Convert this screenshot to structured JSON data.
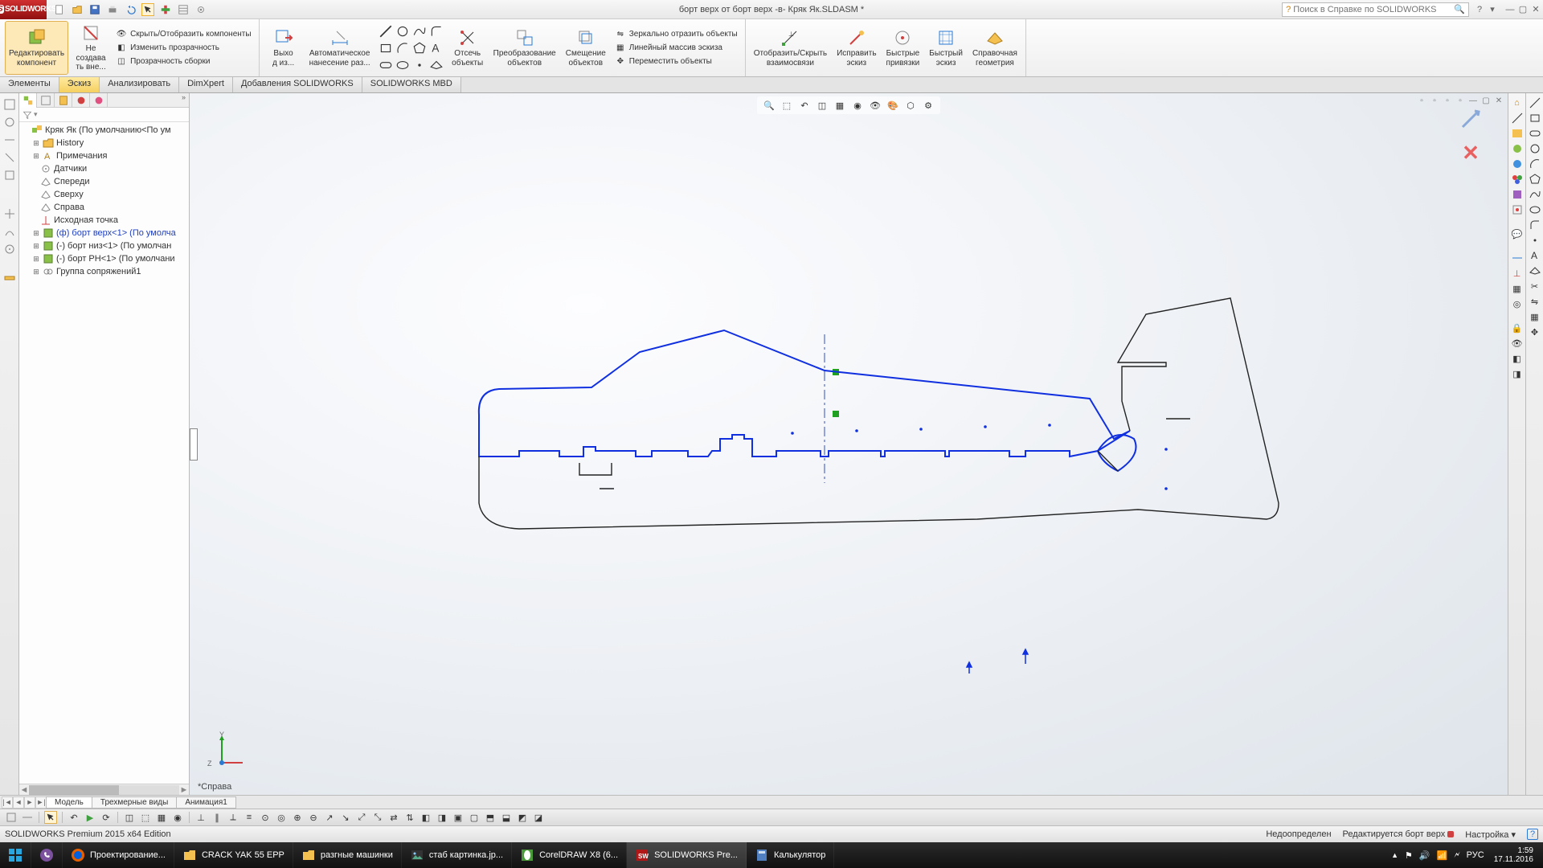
{
  "title": "борт верх от борт верх -в- Кряк Як.SLDASM *",
  "search_placeholder": "Поиск в Справке по SOLIDWORKS",
  "ribbon": {
    "edit_component": "Редактировать\nкомпонент",
    "no_external": "Не\nсоздава\nть вне...",
    "hide_show_components": "Скрыть/Отобразить компоненты",
    "change_transparency": "Изменить прозрачность",
    "assembly_transparency": "Прозрачность сборки",
    "exit": "Выхо\nд из...",
    "auto_dimension": "Автоматическое\nнанесение раз...",
    "trim": "Отсечь\nобъекты",
    "convert": "Преобразование\nобъектов",
    "offset": "Смещение\nобъектов",
    "mirror": "Зеркально отразить объекты",
    "linear_pattern": "Линейный массив эскиза",
    "move": "Переместить объекты",
    "display_relations": "Отобразить/Скрыть\nвзаимосвязи",
    "repair": "Исправить\nэскиз",
    "quick_snaps": "Быстрые\nпривязки",
    "rapid_sketch": "Быстрый\nэскиз",
    "reference_geometry": "Справочная\nгеометрия"
  },
  "tabs": {
    "features": "Элементы",
    "sketch": "Эскиз",
    "evaluate": "Анализировать",
    "dimxpert": "DimXpert",
    "addins": "Добавления SOLIDWORKS",
    "mbd": "SOLIDWORKS MBD"
  },
  "tree": {
    "root": "Кряк Як  (По умолчанию<По ум",
    "history": "History",
    "annotations": "Примечания",
    "sensors": "Датчики",
    "front": "Спереди",
    "top": "Сверху",
    "right": "Справа",
    "origin": "Исходная точка",
    "part1": "(ф) борт верх<1>  (По умолча",
    "part2": "(-) борт низ<1>  (По умолчан",
    "part3": "(-) борт РН<1>  (По умолчани",
    "mates": "Группа сопряжений1"
  },
  "view_name": "*Справа",
  "axes": {
    "y": "Y",
    "z": "Z"
  },
  "viewtabs": {
    "model": "Модель",
    "views3d": "Трехмерные виды",
    "anim": "Анимация1"
  },
  "status": {
    "edition": "SOLIDWORKS Premium 2015 x64 Edition",
    "under_defined": "Недоопределен",
    "editing": "Редактируется борт верх",
    "customize": "Настройка"
  },
  "taskbar": {
    "t1": "Проектирование...",
    "t2": "CRACK YAK 55 EPP",
    "t3": "разгные машинки",
    "t4": "стаб картинка.jp...",
    "t5": "CorelDRAW X8 (6...",
    "t6": "SOLIDWORKS Pre...",
    "t7": "Калькулятор",
    "lang": "РУС",
    "time": "1:59",
    "date": "17.11.2016"
  }
}
